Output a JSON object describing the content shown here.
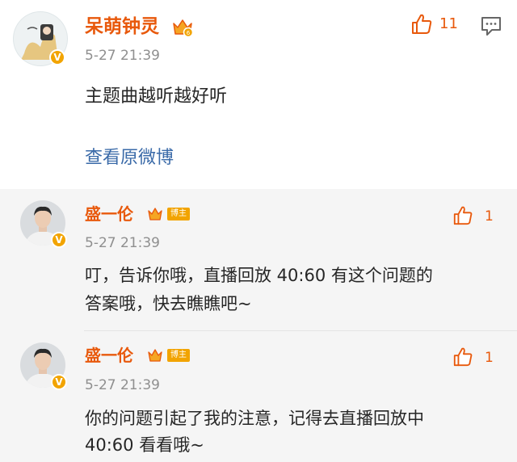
{
  "comment": {
    "username": "呆萌钟灵",
    "verified_mark": "V",
    "timestamp": "5-27 21:39",
    "text": "主题曲越听越好听",
    "like_count": "11",
    "view_original_link": "查看原微博"
  },
  "replies": [
    {
      "username": "盛一伦",
      "badge": "博主",
      "verified_mark": "V",
      "timestamp": "5-27 21:39",
      "text_line1": "叮，告诉你哦，直播回放 40:60 有这个问题的",
      "text_line2": "答案哦，快去瞧瞧吧~",
      "like_count": "1"
    },
    {
      "username": "盛一伦",
      "badge": "博主",
      "verified_mark": "V",
      "timestamp": "5-27 21:39",
      "text_line1": "你的问题引起了我的注意，记得去直播回放中",
      "text_line2": "40:60 看看哦~",
      "like_count": "1"
    }
  ],
  "colors": {
    "username": "#e8590c",
    "link": "#3a6aa8",
    "verified_badge": "#f2a400",
    "reply_background": "#f5f5f5"
  },
  "icons": [
    "like-icon",
    "comment-icon",
    "crown-icon",
    "verified-icon"
  ]
}
